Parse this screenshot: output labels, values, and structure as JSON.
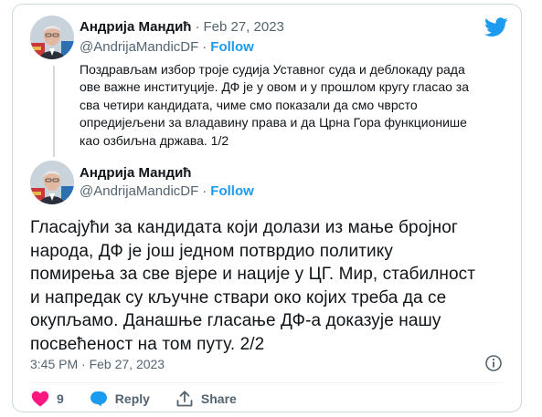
{
  "tweet1": {
    "author_name": "Андрија Мандић",
    "date": "Feb 27, 2023",
    "handle": "@AndrijaMandicDF",
    "follow_label": "Follow",
    "text_lines": [
      "Поздрављам избор троје судија Уставног суда и деблокаду рада",
      "ове важне институције. ДФ је у овом и у прошлом кругу гласао за",
      "сва четири кандидата, чиме смо показали да смо чврсто",
      "опредијељени за владавину права и да Црна Гора функционише",
      "као озбиљна држава. 1/2"
    ]
  },
  "tweet2": {
    "author_name": "Андрија Мандић",
    "handle": "@AndrijaMandicDF",
    "follow_label": "Follow",
    "text_lines": [
      "Гласајући за кандидата који долази из мање бројног",
      "народа, ДФ је још једном потврдио политику",
      "помирења за све вјере и нације у ЦГ. Мир, стабилност",
      "и напредак су кључне ствари око којих треба да се",
      "окупљамо. Данашње гласање ДФ-а доказује нашу",
      "посвећеност на том путу. 2/2"
    ],
    "timestamp": "3:45 PM · Feb 27, 2023"
  },
  "actions": {
    "like_count": "9",
    "reply_label": "Reply",
    "share_label": "Share"
  },
  "icons": {
    "brand": "twitter-bird-icon",
    "info": "info-icon",
    "like": "heart-icon",
    "reply": "reply-bubble-icon",
    "share": "share-upload-icon"
  },
  "colors": {
    "brand_blue": "#1d9bf0",
    "heart": "#f91880",
    "muted": "#536471",
    "text": "#0f1419",
    "border": "#cfd9de"
  }
}
